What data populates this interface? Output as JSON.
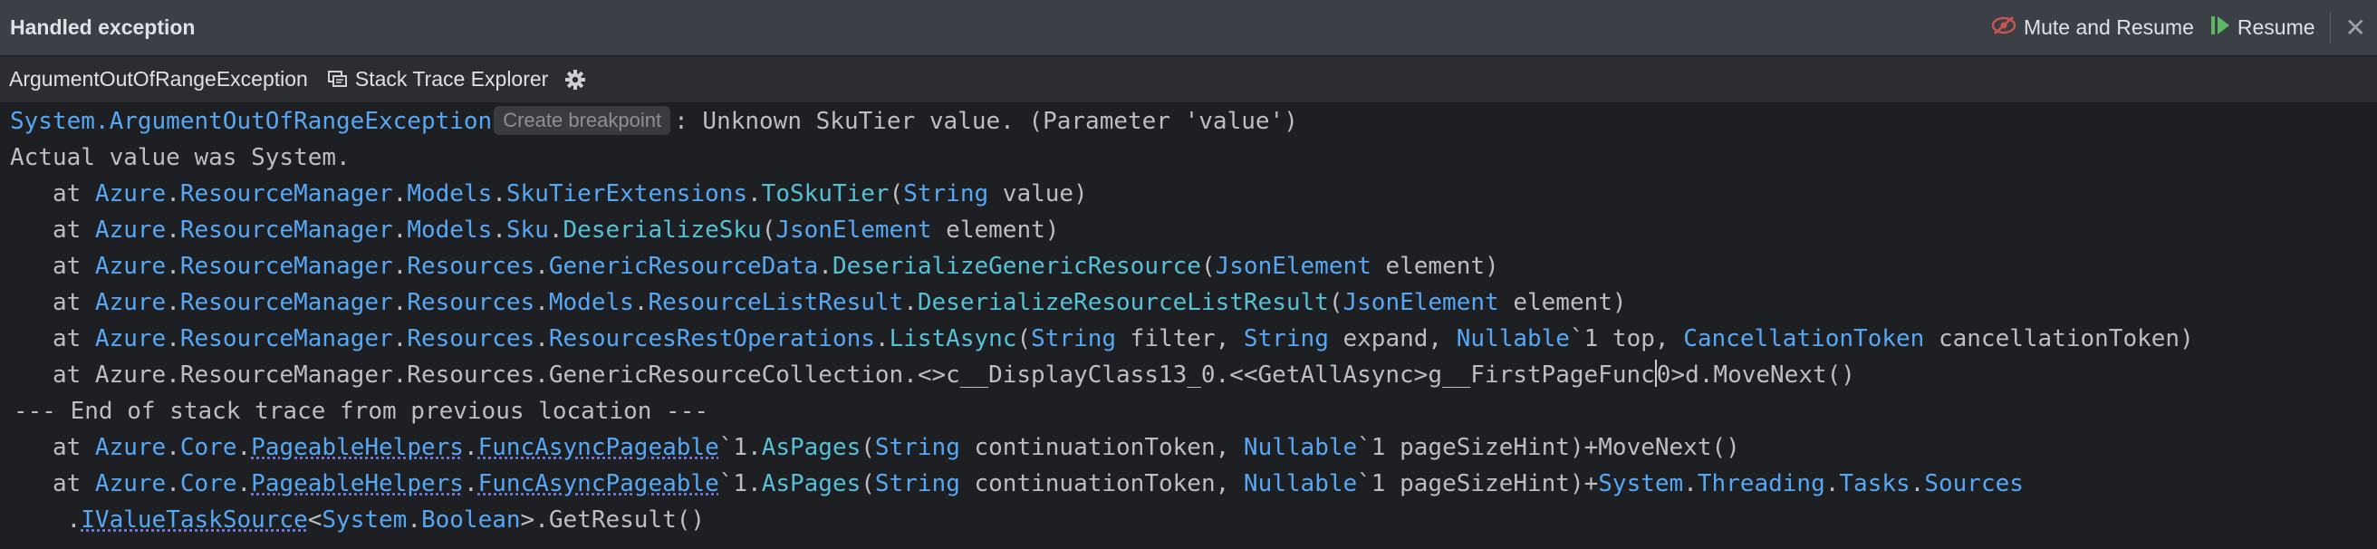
{
  "header": {
    "title": "Handled exception",
    "mute_resume_label": "Mute and Resume",
    "resume_label": "Resume",
    "close_glyph": "✕",
    "colors": {
      "resume_icon": "#5fb865",
      "mute_icon": "#e06c75"
    }
  },
  "toolbar": {
    "exception_name": "ArgumentOutOfRangeException",
    "stack_trace_explorer_label": "Stack Trace Explorer"
  },
  "trace": {
    "line1": {
      "exception_type": "System.ArgumentOutOfRangeException",
      "create_breakpoint": "Create breakpoint",
      "message": ": Unknown SkuTier value. (Parameter 'value')"
    },
    "line2": "Actual value was System.",
    "frame1": {
      "prefix": "   at ",
      "ns1": "Azure",
      "ns2": "ResourceManager",
      "ns3": "Models",
      "type": "SkuTierExtensions",
      "method": "ToSkuTier",
      "argtype": "String",
      "args": " value)"
    },
    "frame2": {
      "prefix": "   at ",
      "ns1": "Azure",
      "ns2": "ResourceManager",
      "ns3": "Models",
      "type": "Sku",
      "method": "DeserializeSku",
      "argtype": "JsonElement",
      "args": " element)"
    },
    "frame3": {
      "prefix": "   at ",
      "ns1": "Azure",
      "ns2": "ResourceManager",
      "ns3": "Resources",
      "type": "GenericResourceData",
      "method": "DeserializeGenericResource",
      "argtype": "JsonElement",
      "args": " element)"
    },
    "frame4": {
      "prefix": "   at ",
      "ns1": "Azure",
      "ns2": "ResourceManager",
      "ns3": "Resources",
      "ns4": "Models",
      "type": "ResourceListResult",
      "method": "DeserializeResourceListResult",
      "argtype": "JsonElement",
      "args": " element)"
    },
    "frame5": {
      "prefix": "   at ",
      "ns1": "Azure",
      "ns2": "ResourceManager",
      "ns3": "Resources",
      "type": "ResourcesRestOperations",
      "method": "ListAsync",
      "t1": "String",
      "a1": " filter, ",
      "t2": "String",
      "a2": " expand, ",
      "t3": "Nullable",
      "a3": "`1 top, ",
      "t4": "CancellationToken",
      "a4": " cancellationToken)"
    },
    "frame6": {
      "before_caret": "   at Azure.ResourceManager.Resources.GenericResourceCollection.<>c__DisplayClass13_0.<<GetAllAsync>g__FirstPageFunc",
      "after_caret": "0>d.MoveNext()"
    },
    "separator": "--- End of stack trace from previous location ---",
    "frame7": {
      "prefix": "   at ",
      "ns1": "Azure",
      "ns2": "Core",
      "type": "PageableHelpers",
      "type2": "FuncAsyncPageable",
      "method_prefix": "`1.",
      "method": "AsPages",
      "t1": "String",
      "a1": " continuationToken, ",
      "t2": "Nullable",
      "a2": "`1 pageSizeHint)+MoveNext()"
    },
    "frame8": {
      "prefix": "   at ",
      "ns1": "Azure",
      "ns2": "Core",
      "type": "PageableHelpers",
      "type2": "FuncAsyncPageable",
      "method_prefix": "`1.",
      "method": "AsPages",
      "t1": "String",
      "a1": " continuationToken, ",
      "t2": "Nullable",
      "a2": "`1 pageSizeHint)+",
      "s1": "System",
      "s2": "Threading",
      "s3": "Tasks",
      "s4": "Sources"
    },
    "frame8_cont": {
      "prefix": "    .",
      "iface": "IValueTaskSource",
      "lt": "<",
      "gen1": "System",
      "gen2": "Boolean",
      "rest": ">.GetResult()"
    }
  }
}
